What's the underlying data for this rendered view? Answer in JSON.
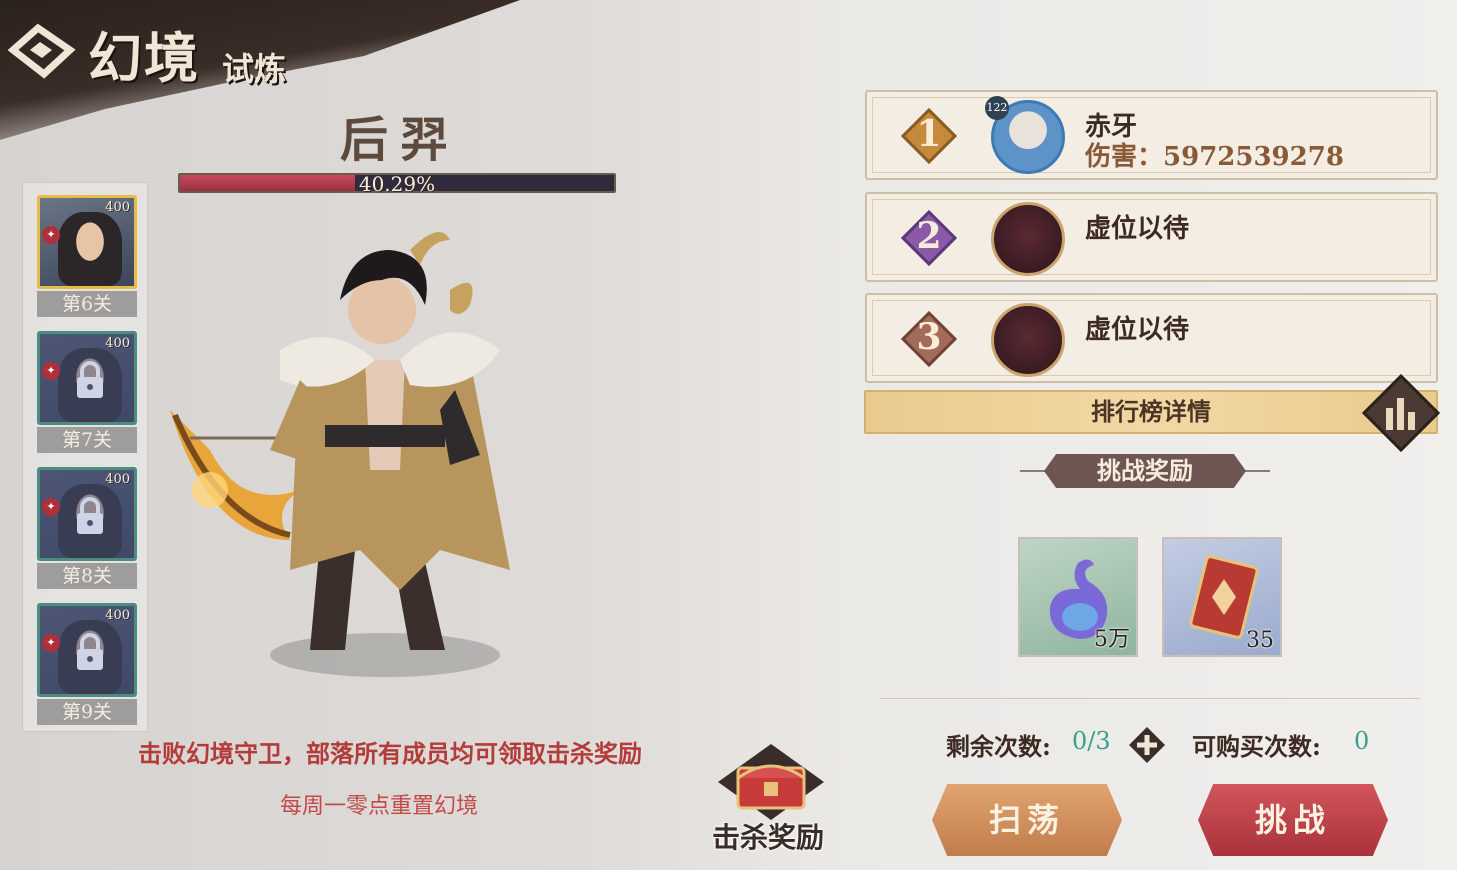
{
  "banner": {
    "title": "幻境",
    "subtitle": "试炼"
  },
  "boss": {
    "name": "后羿",
    "hp_percent_text": "40.29%",
    "hp_fraction": 0.4029
  },
  "stages": [
    {
      "label": "第6关",
      "level": "400",
      "locked": false,
      "active": true
    },
    {
      "label": "第7关",
      "level": "400",
      "locked": true,
      "active": false
    },
    {
      "label": "第8关",
      "level": "400",
      "locked": true,
      "active": false
    },
    {
      "label": "第9关",
      "level": "400",
      "locked": true,
      "active": false
    }
  ],
  "info": {
    "defeat_text": "击败幻境守卫，部落所有成员均可领取击杀奖励",
    "reset_text": "每周一零点重置幻境",
    "kill_reward_label": "击杀奖励"
  },
  "ranking": [
    {
      "rank": "1",
      "name": "赤牙",
      "damage_label": "伤害：",
      "damage": "5972539278",
      "avatar_level": "122"
    },
    {
      "rank": "2",
      "vacant": "虚位以待"
    },
    {
      "rank": "3",
      "vacant": "虚位以待"
    }
  ],
  "ranking_detail_label": "排行榜详情",
  "rewards": {
    "title": "挑战奖励",
    "items": [
      {
        "icon": "spirit-flame-icon",
        "qty": "5万"
      },
      {
        "icon": "card-pack-icon",
        "qty": "35"
      }
    ]
  },
  "counts": {
    "remaining_label": "剩余次数:",
    "remaining_value": "0/3",
    "purchasable_label": "可购买次数:",
    "purchasable_value": "0"
  },
  "buttons": {
    "sweep": "扫荡",
    "challenge": "挑战"
  },
  "colors": {
    "hp_fill": "#c44a5d",
    "sweep_button": "#d39160",
    "challenge_button": "#c0444d",
    "count_value": "#3aa08a"
  }
}
